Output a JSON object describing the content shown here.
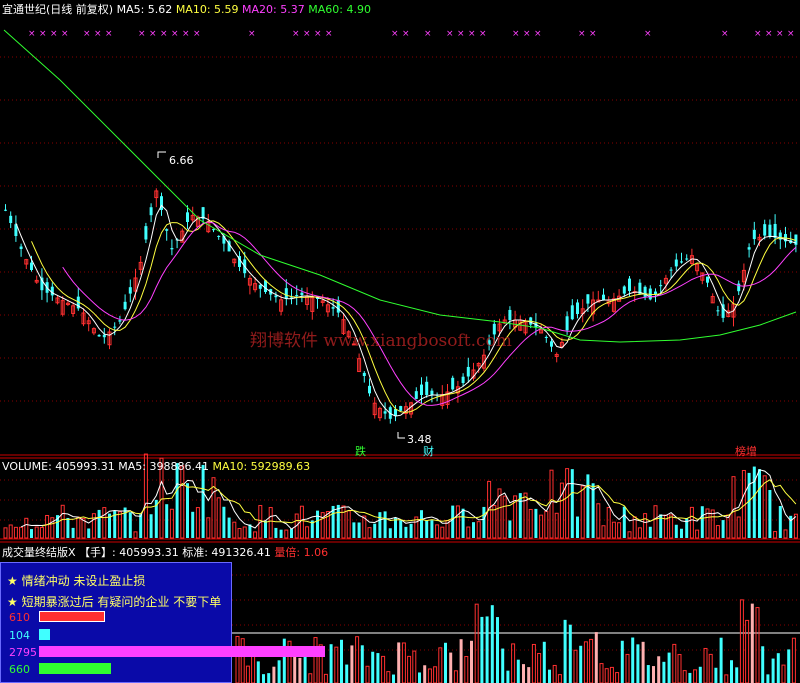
{
  "header": {
    "stock_label": "宜通世纪(日线 前复权)",
    "ma5_label": "MA5: 5.62",
    "ma10_label": "MA10: 5.59",
    "ma20_label": "MA20: 5.37",
    "ma60_label": "MA60: 4.90"
  },
  "price_panel": {
    "high_label": "6.66",
    "low_label": "3.48",
    "watermark": "翔博软件 www.xiangbosoft.com",
    "tags": [
      "跌",
      "财",
      "榜增"
    ],
    "marker_char": "×"
  },
  "volume_panel": {
    "vol_label": "VOLUME: 405993.31",
    "ma5_label": "MA5: 398886.41",
    "ma10_label": "MA10: 592989.63"
  },
  "indicator_panel": {
    "name_label": "成交量终结版X",
    "unit_label": "【手】: 405993.31",
    "std_label": "标准: 491326.41",
    "ratio_label": "量倍: 1.06"
  },
  "info_box": {
    "line1": "★ 情绪冲动 未设止盈止损",
    "line2": "★ 短期暴涨过后 有疑问的企业 不要下单",
    "rows": [
      {
        "num": "610",
        "pct": 0.23,
        "color": "#ff3030",
        "outline": true
      },
      {
        "num": "104",
        "pct": 0.04,
        "color": "#40ffff",
        "outline": false
      },
      {
        "num": "2795",
        "pct": 1.0,
        "color": "#ff40ff",
        "outline": false
      },
      {
        "num": "660",
        "pct": 0.25,
        "color": "#30ff30",
        "outline": false
      }
    ]
  },
  "colors": {
    "up": "#ff3030",
    "down": "#40ffff",
    "ma5": "#ffffff",
    "ma10": "#ffff40",
    "ma20": "#ff40ff",
    "ma60": "#30ff30",
    "grid": "#880000"
  }
}
